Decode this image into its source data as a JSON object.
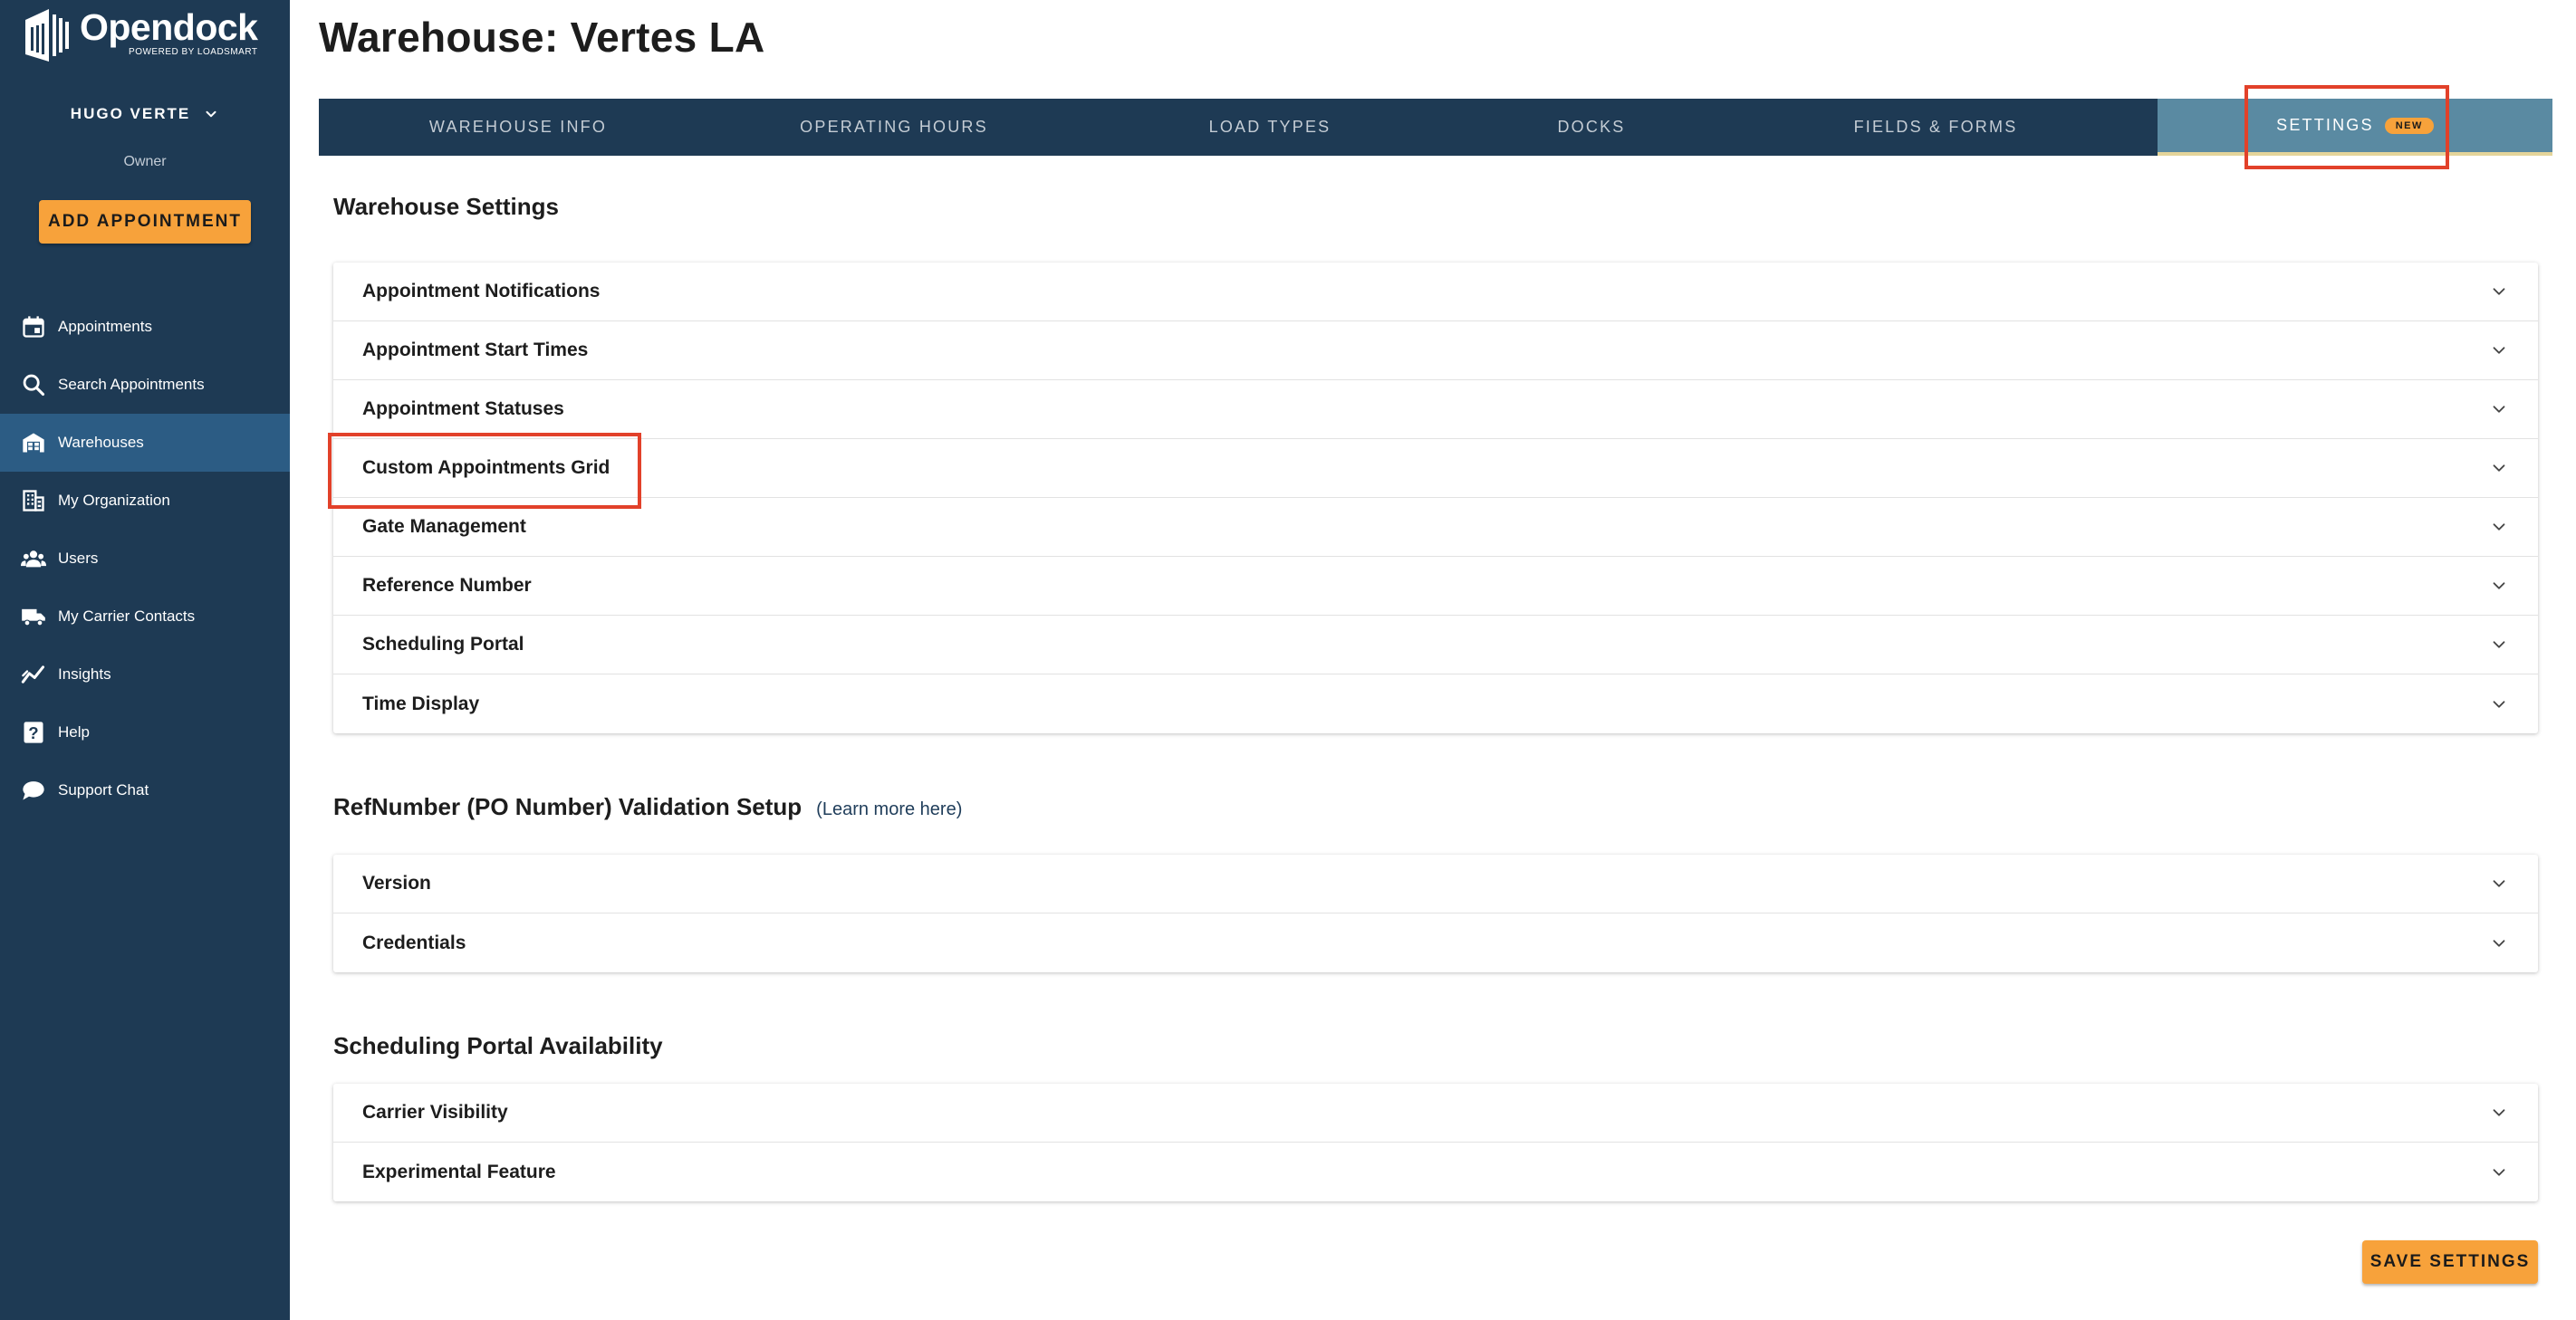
{
  "app": {
    "name": "Opendock",
    "tagline": "POWERED BY LOADSMART"
  },
  "user": {
    "name": "HUGO VERTE",
    "role": "Owner"
  },
  "sidebar": {
    "add_button": "ADD APPOINTMENT",
    "items": [
      {
        "label": "Appointments",
        "icon": "calendar-icon"
      },
      {
        "label": "Search Appointments",
        "icon": "search-icon"
      },
      {
        "label": "Warehouses",
        "icon": "warehouse-icon",
        "active": true
      },
      {
        "label": "My Organization",
        "icon": "building-icon"
      },
      {
        "label": "Users",
        "icon": "users-icon"
      },
      {
        "label": "My Carrier Contacts",
        "icon": "truck-icon"
      },
      {
        "label": "Insights",
        "icon": "chart-line-icon"
      },
      {
        "label": "Help",
        "icon": "help-icon"
      },
      {
        "label": "Support Chat",
        "icon": "chat-bubble-icon"
      }
    ]
  },
  "page": {
    "title": "Warehouse: Vertes LA"
  },
  "tabs": [
    {
      "label": "WAREHOUSE INFO"
    },
    {
      "label": "OPERATING HOURS"
    },
    {
      "label": "LOAD TYPES"
    },
    {
      "label": "DOCKS"
    },
    {
      "label": "FIELDS & FORMS"
    },
    {
      "label": "SETTINGS",
      "badge": "NEW",
      "active": true
    }
  ],
  "sections": {
    "warehouse_settings": {
      "title": "Warehouse Settings",
      "rows": [
        "Appointment Notifications",
        "Appointment Start Times",
        "Appointment Statuses",
        "Custom Appointments Grid",
        "Gate Management",
        "Reference Number",
        "Scheduling Portal",
        "Time Display"
      ]
    },
    "refnumber": {
      "title": "RefNumber (PO Number) Validation Setup",
      "link": "(Learn more here)",
      "rows": [
        "Version",
        "Credentials"
      ]
    },
    "portal_availability": {
      "title": "Scheduling Portal Availability",
      "rows": [
        "Carrier Visibility",
        "Experimental Feature"
      ]
    }
  },
  "save_button": "SAVE SETTINGS",
  "colors": {
    "sidebar_bg": "#1e3a54",
    "sidebar_active": "#2c5c84",
    "accent": "#f7a23b",
    "tab_active_bg": "#5a8aa2",
    "highlight": "#e2412a"
  }
}
